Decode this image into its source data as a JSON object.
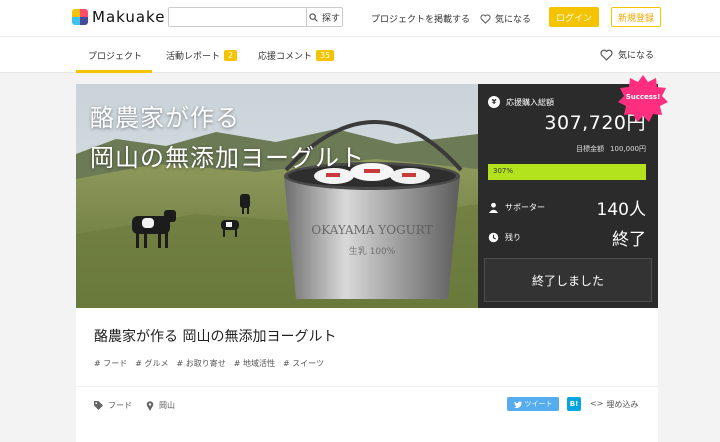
{
  "header": {
    "logo_text": "Makuake",
    "search_placeholder": "",
    "search_button": "探す",
    "nav_post": "プロジェクトを掲載する",
    "nav_favorite": "気になる",
    "login": "ログイン",
    "signup": "新規登録"
  },
  "tabs": [
    {
      "label": "プロジェクト"
    },
    {
      "label": "活動レポート",
      "badge": "2"
    },
    {
      "label": "応援コメント",
      "badge": "35"
    }
  ],
  "favorite_right": "気になる",
  "hero": {
    "title_line1": "酪農家が作る",
    "title_line2": "岡山の無添加ヨーグルト",
    "bucket_text": "OKAYAMA YOGURT",
    "bucket_sub": "生乳 100%"
  },
  "panel": {
    "total_label": "応援購入総額",
    "amount": "307,720円",
    "goal_label": "目標金額",
    "goal_value": "100,000円",
    "progress_text": "307%",
    "progress_fraction": 1.0,
    "supporters_label": "サポーター",
    "supporters_value": "140人",
    "remaining_label": "残り",
    "remaining_value": "終了",
    "ended_button": "終了しました",
    "success_badge": "Success!"
  },
  "info": {
    "title": "酪農家が作る 岡山の無添加ヨーグルト",
    "tags": [
      "# フード",
      "# グルメ",
      "# お取り寄せ",
      "# 地域活性",
      "# スイーツ"
    ],
    "category": "フード",
    "location": "岡山",
    "tweet": "ツイート",
    "hatena": "B!",
    "embed": "埋め込み"
  },
  "colors": {
    "accent": "#f5c400",
    "panel_bg": "#2b2b2b",
    "progress": "#b3e31d",
    "success": "#ff2e7e",
    "twitter": "#55acee"
  }
}
